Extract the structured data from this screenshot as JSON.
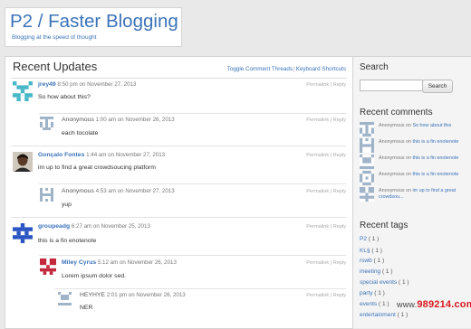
{
  "site": {
    "title": "P2 / Faster Blogging",
    "tagline": "Blogging at the speed of thought"
  },
  "main": {
    "title": "Recent Updates",
    "links": [
      "Toggle Comment Threads",
      "Keyboard Shortcuts"
    ],
    "link_sep": "|"
  },
  "entries": [
    {
      "author": "jrey49",
      "meta": "8:50 pm on November 27, 2013",
      "actions": "Permalink | Reply",
      "content": "So how about this?"
    },
    {
      "author": "Anonymous",
      "meta": "1:00 am on November 26, 2013",
      "actions": "Permalink | Reply",
      "content": "each tocolate"
    },
    {
      "author": "Gonçalo Fontes",
      "meta": "1:44 am on November 27, 2013",
      "actions": "Permalink | Reply",
      "content": "im up to find a great crowdsoucing platform"
    },
    {
      "author": "Anonymous",
      "meta": "4:53 am on November 27, 2013",
      "actions": "Permalink | Reply",
      "content": "yup"
    },
    {
      "author": "groupeadg",
      "meta": "6:27 am on November 25, 2013",
      "actions": "Permalink | Reply",
      "content": "this is a fin enotenote"
    },
    {
      "author": "Miley Cyrus",
      "meta": "5:12 am on November 26, 2013",
      "actions": "Permalink | Reply",
      "content": "Lorem ipsum dolor sed."
    },
    {
      "author": "HEYHYE",
      "meta": "2:01 pm on November 26, 2013",
      "actions": "Permalink | Reply",
      "content": "NER"
    }
  ],
  "sidebar": {
    "search_heading": "Search",
    "search_button": "Search",
    "search_value": "",
    "comments_heading": "Recent comments",
    "comments": [
      {
        "author": "Anonymous",
        "on": "on",
        "link": "So how about this"
      },
      {
        "author": "Anonymous",
        "on": "on",
        "link": "this is a fin enotenote"
      },
      {
        "author": "Anonymous",
        "on": "on",
        "link": "this is a fin enotenote"
      },
      {
        "author": "Anonymous",
        "on": "on",
        "link": "this is a fin enotenote"
      },
      {
        "author": "Anonymous",
        "on": "on",
        "link": "im up to find a great crowdsou..."
      }
    ],
    "tags_heading": "Recent tags",
    "tags": [
      {
        "name": "P2",
        "count": "( 1 )"
      },
      {
        "name": "KL§",
        "count": "( 1 )"
      },
      {
        "name": "rswb",
        "count": "( 1 )"
      },
      {
        "name": "meeting",
        "count": "( 1 )"
      },
      {
        "name": "special events",
        "count": "( 1 )"
      },
      {
        "name": "party",
        "count": "( 1 )"
      },
      {
        "name": "events",
        "count": "( 1 )"
      },
      {
        "name": "entertainment",
        "count": "( 1 )"
      }
    ]
  },
  "watermark": {
    "prefix": "www.",
    "text": "989214.com"
  },
  "colors": {
    "link": "#3b73b9",
    "border": "#d4d4d4",
    "sidebar_bg": "#f4f4f4",
    "page_bg": "#e9e9e9"
  },
  "icons": {
    "avatar_default": "identicon-avatar",
    "avatar_photo": "user-photo-avatar"
  }
}
